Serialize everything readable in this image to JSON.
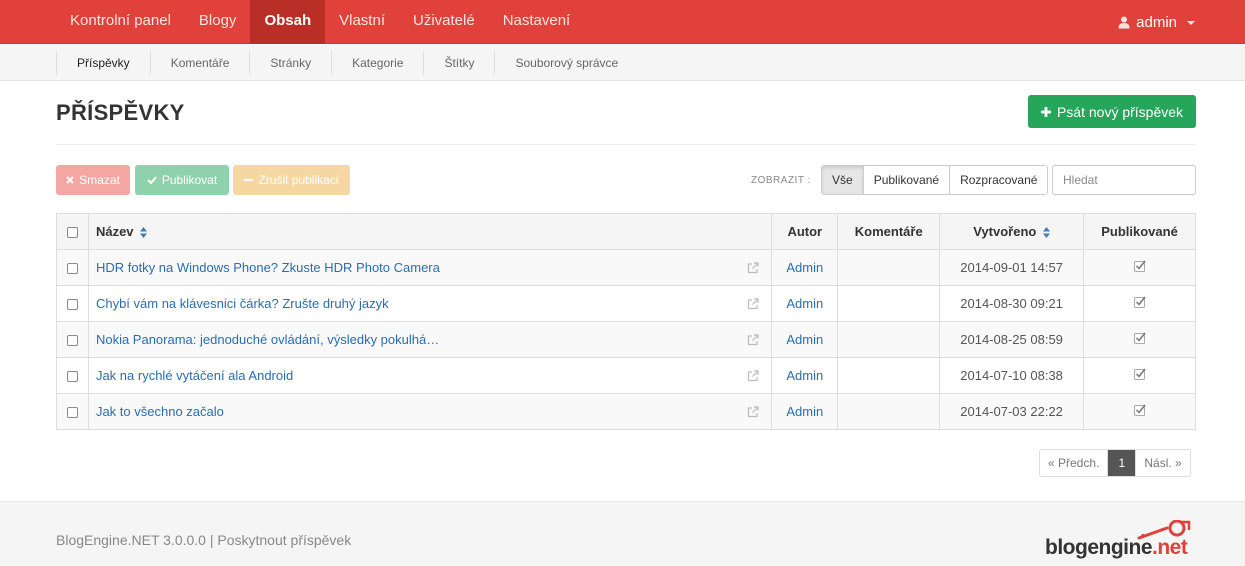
{
  "colors": {
    "brand": "#e0413a",
    "accent_green": "#26a65b",
    "link": "#2a6db0"
  },
  "topnav": {
    "items": [
      {
        "label": "Kontrolní panel"
      },
      {
        "label": "Blogy"
      },
      {
        "label": "Obsah"
      },
      {
        "label": "Vlastní"
      },
      {
        "label": "Uživatelé"
      },
      {
        "label": "Nastavení"
      }
    ],
    "active_index": 2,
    "user": {
      "name": "admin",
      "icon": "user-icon"
    }
  },
  "subnav": {
    "items": [
      {
        "label": "Příspěvky"
      },
      {
        "label": "Komentáře"
      },
      {
        "label": "Stránky"
      },
      {
        "label": "Kategorie"
      },
      {
        "label": "Štítky"
      },
      {
        "label": "Souborový správce"
      }
    ],
    "active_index": 0
  },
  "header": {
    "title": "PŘÍSPĚVKY",
    "new_button": "Psát nový příspěvek"
  },
  "actions": {
    "delete": "Smazat",
    "publish": "Publikovat",
    "unpublish": "Zrušit publikaci"
  },
  "filter": {
    "label": "ZOBRAZIT :",
    "options": [
      "Vše",
      "Publikované",
      "Rozpracované"
    ],
    "active_index": 0
  },
  "search": {
    "placeholder": "Hledat"
  },
  "table": {
    "headers": {
      "name": "Název",
      "author": "Autor",
      "comments": "Komentáře",
      "created": "Vytvořeno",
      "published": "Publikované"
    },
    "rows": [
      {
        "title": "HDR fotky na Windows Phone? Zkuste HDR Photo Camera",
        "author": "Admin",
        "comments": "",
        "created": "2014-09-01 14:57",
        "published": true
      },
      {
        "title": "Chybí vám na klávesnici čárka? Zrušte druhý jazyk",
        "author": "Admin",
        "comments": "",
        "created": "2014-08-30 09:21",
        "published": true
      },
      {
        "title": "Nokia Panorama: jednoduché ovládání, výsledky pokulhá…",
        "author": "Admin",
        "comments": "",
        "created": "2014-08-25 08:59",
        "published": true
      },
      {
        "title": "Jak na rychlé vytáčení ala Android",
        "author": "Admin",
        "comments": "",
        "created": "2014-07-10 08:38",
        "published": true
      },
      {
        "title": "Jak to všechno začalo",
        "author": "Admin",
        "comments": "",
        "created": "2014-07-03 22:22",
        "published": true
      }
    ]
  },
  "pagination": {
    "prev": "« Předch.",
    "current": "1",
    "next": "Násl. »"
  },
  "footer": {
    "version": "BlogEngine.NET 3.0.0.0",
    "separator": " | ",
    "link": "Poskytnout příspěvek",
    "logo_main": "blogengine",
    "logo_suffix": ".net"
  }
}
